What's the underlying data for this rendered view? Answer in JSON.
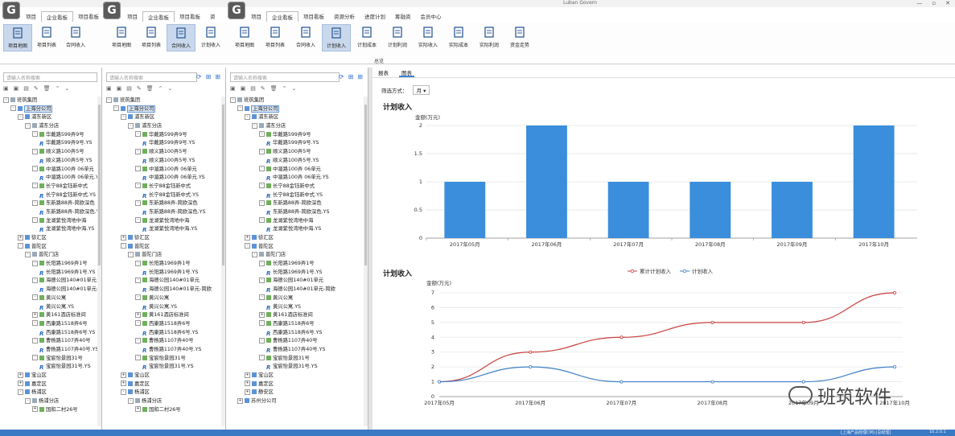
{
  "window": {
    "title": "Luban Govern",
    "controls": [
      "—",
      "▫",
      "✕"
    ]
  },
  "menus": {
    "left": [
      "项目",
      "企业看板",
      "项目看板"
    ],
    "middle": [
      "项目",
      "企业看板",
      "项目看板",
      "资"
    ],
    "right": [
      "项目",
      "企业看板",
      "项目看板",
      "资源分析",
      "进度计划",
      "筹融资",
      "会员中心"
    ]
  },
  "ribbon": {
    "left": [
      "项目地图",
      "项目列表",
      "合同收入"
    ],
    "middle": [
      "项目地图",
      "项目列表",
      "合同收入",
      "计划收入"
    ],
    "right": [
      "项目地图",
      "项目列表",
      "合同收入",
      "计划收入",
      "计划成本",
      "计划利润",
      "实际收入",
      "实际成本",
      "实际利润",
      "资金走势"
    ],
    "group_label": "总览"
  },
  "panels": {
    "search_placeholder": "请输入名称搜索",
    "tree": [
      {
        "d": 0,
        "t": "班筑集团",
        "k": "root",
        "tg": "-"
      },
      {
        "d": 1,
        "t": "上海分公司",
        "k": "co",
        "tg": "-",
        "sel": true
      },
      {
        "d": 2,
        "t": "浦东新区",
        "k": "dist",
        "tg": "-"
      },
      {
        "d": 3,
        "t": "浦东分店",
        "k": "store",
        "tg": "-"
      },
      {
        "d": 4,
        "t": "华戴路599弄9号",
        "k": "proj",
        "tg": "-"
      },
      {
        "d": 5,
        "t": "华戴路599弄9号.YS",
        "k": "ys"
      },
      {
        "d": 4,
        "t": "顺义路100弄5号",
        "k": "proj",
        "tg": "-"
      },
      {
        "d": 5,
        "t": "顺义路100弄5号.YS",
        "k": "ys"
      },
      {
        "d": 4,
        "t": "中湄路100弄 06单元",
        "k": "proj",
        "tg": "-"
      },
      {
        "d": 5,
        "t": "中湄路100弄 06单元.YS",
        "k": "ys"
      },
      {
        "d": 4,
        "t": "长宁88金钰新中式",
        "k": "proj",
        "tg": "-"
      },
      {
        "d": 5,
        "t": "长宁88金钰新中式.YS",
        "k": "ys"
      },
      {
        "d": 4,
        "t": "东新路88弄-简欧深色",
        "k": "proj",
        "tg": "-"
      },
      {
        "d": 5,
        "t": "东新路88弄-简欧深色.YS",
        "k": "ys"
      },
      {
        "d": 4,
        "t": "龙湖紫悦湾地中海",
        "k": "proj",
        "tg": "-"
      },
      {
        "d": 5,
        "t": "龙湖紫悦湾地中海.YS",
        "k": "ys"
      },
      {
        "d": 2,
        "t": "徐汇区",
        "k": "dist",
        "tg": "+"
      },
      {
        "d": 2,
        "t": "普陀区",
        "k": "dist",
        "tg": "-"
      },
      {
        "d": 3,
        "t": "普陀门店",
        "k": "store",
        "tg": "-"
      },
      {
        "d": 4,
        "t": "长阳路1969弄1号",
        "k": "proj",
        "tg": "-"
      },
      {
        "d": 5,
        "t": "长阳路1969弄1号.YS",
        "k": "ys"
      },
      {
        "d": 4,
        "t": "海德公园140#01单元",
        "k": "proj",
        "tg": "-"
      },
      {
        "d": 5,
        "t": "海德公园140#01单元-简欧",
        "k": "ys"
      },
      {
        "d": 4,
        "t": "黄兴公寓",
        "k": "proj",
        "tg": "-"
      },
      {
        "d": 5,
        "t": "黄兴公寓.YS",
        "k": "ys"
      },
      {
        "d": 4,
        "t": "黄161酒店标准间",
        "k": "proj",
        "tg": "+"
      },
      {
        "d": 4,
        "t": "西康路1518弄6号",
        "k": "proj",
        "tg": "-"
      },
      {
        "d": 5,
        "t": "西康路1518弄6号.YS",
        "k": "ys"
      },
      {
        "d": 4,
        "t": "曹杨路1107弄40号",
        "k": "proj",
        "tg": "-"
      },
      {
        "d": 5,
        "t": "曹杨路1107弄40号.YS",
        "k": "ys"
      },
      {
        "d": 4,
        "t": "宝宸怡景园31号",
        "k": "proj",
        "tg": "-"
      },
      {
        "d": 5,
        "t": "宝宸怡景园31号.YS",
        "k": "ys"
      },
      {
        "d": 2,
        "t": "宝山区",
        "k": "dist",
        "tg": "+"
      },
      {
        "d": 2,
        "t": "嘉定区",
        "k": "dist",
        "tg": "+"
      },
      {
        "d": 2,
        "t": "杨浦区",
        "k": "dist",
        "tg": "-"
      },
      {
        "d": 3,
        "t": "杨浦分店",
        "k": "store",
        "tg": "-"
      },
      {
        "d": 4,
        "t": "国和二村26号",
        "k": "proj",
        "tg": "+"
      }
    ],
    "tree_tail_right": [
      {
        "d": 2,
        "t": "静安区",
        "k": "dist",
        "tg": "+"
      },
      {
        "d": 1,
        "t": "苏州分公司",
        "k": "co",
        "tg": "+"
      }
    ]
  },
  "report": {
    "tabs": [
      "报表",
      "图表"
    ],
    "filter_label": "筛选方式：",
    "filter_value": "月"
  },
  "chart_data": [
    {
      "type": "bar",
      "title": "计划收入",
      "ylabel": "金额(万元)",
      "categories": [
        "2017年05月",
        "2017年06月",
        "2017年07月",
        "2017年08月",
        "2017年09月",
        "2017年10月"
      ],
      "values": [
        1,
        2,
        1,
        1,
        1,
        2
      ],
      "ylim": [
        0,
        2
      ],
      "yticks": [
        0,
        0.5,
        1,
        1.5,
        2
      ],
      "color": "#3a8edb",
      "grid": true
    },
    {
      "type": "line",
      "title": "计划收入",
      "ylabel": "金额(万元)",
      "categories": [
        "2017年05月",
        "2017年06月",
        "2017年07月",
        "2017年08月",
        "2017年09月",
        "2017年10月"
      ],
      "ylim": [
        0,
        7
      ],
      "yticks": [
        0,
        1,
        2,
        3,
        4,
        5,
        6,
        7
      ],
      "legend": "top-center",
      "series": [
        {
          "name": "累计计划收入",
          "values": [
            1,
            3,
            4,
            5,
            5,
            7
          ],
          "color": "#c9403d"
        },
        {
          "name": "计划收入",
          "values": [
            1,
            2,
            1,
            1,
            1,
            2
          ],
          "color": "#3f7fc7"
        }
      ]
    }
  ],
  "status": {
    "left": "[上海产品经理CM]-[总经理]",
    "right": "10.2.0.1"
  },
  "watermark": "班筑软件"
}
